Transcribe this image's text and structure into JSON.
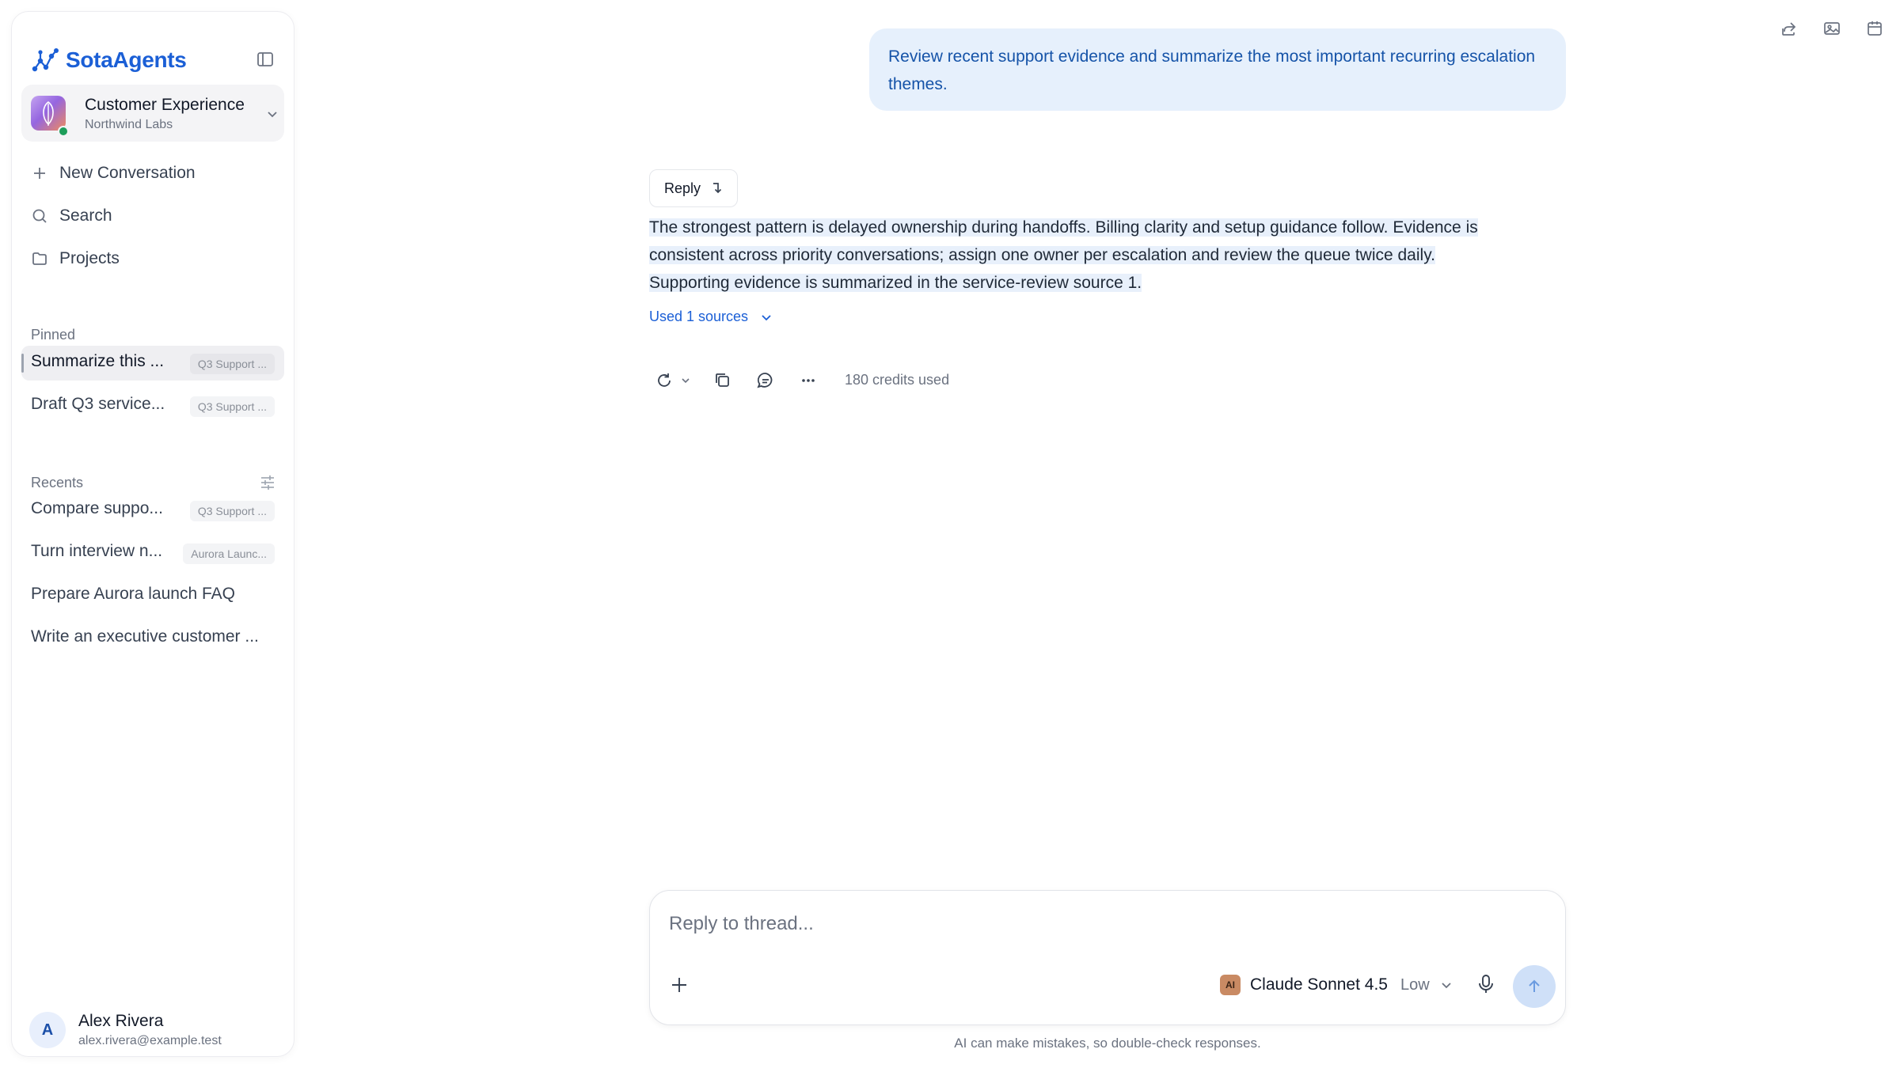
{
  "brand": {
    "name": "SotaAgents",
    "accent": "#1b5fd6"
  },
  "workspace": {
    "name": "Customer Experience",
    "org": "Northwind Labs",
    "status_color": "#1e9e5a"
  },
  "nav": {
    "new_conversation": "New Conversation",
    "search": "Search",
    "projects": "Projects"
  },
  "pinned": {
    "label": "Pinned",
    "items": [
      {
        "title": "Summarize this ...",
        "tag": "Q3 Support ..."
      },
      {
        "title": "Draft Q3 service...",
        "tag": "Q3 Support ..."
      }
    ]
  },
  "recents": {
    "label": "Recents",
    "items": [
      {
        "title": "Compare suppo...",
        "tag": "Q3 Support ..."
      },
      {
        "title": "Turn interview n...",
        "tag": "Aurora Launc..."
      },
      {
        "title": "Prepare Aurora launch FAQ",
        "tag": ""
      },
      {
        "title": "Write an executive customer ...",
        "tag": ""
      }
    ]
  },
  "user": {
    "initial": "A",
    "name": "Alex Rivera",
    "email": "alex.rivera@example.test"
  },
  "header_icons": [
    "share-icon",
    "image-icon",
    "calendar-icon"
  ],
  "conversation": {
    "user_message": "Review recent support evidence and summarize the most important recurring escalation themes.",
    "reply_label": "Reply",
    "answer_lines": [
      "The strongest pattern is delayed ownership during handoffs. Billing clarity and setup guidance follow. Evidence is",
      "consistent across priority conversations; assign one owner per escalation and review the queue twice daily.",
      "Supporting evidence is summarized in the service-review source 1."
    ],
    "sources_label": "Used 1 sources",
    "credits": "180 credits used"
  },
  "composer": {
    "placeholder": "Reply to thread...",
    "model_logo": "AI",
    "model_name": "Claude Sonnet 4.5",
    "model_level": "Low",
    "disclaimer": "AI can make mistakes, so double-check responses."
  }
}
